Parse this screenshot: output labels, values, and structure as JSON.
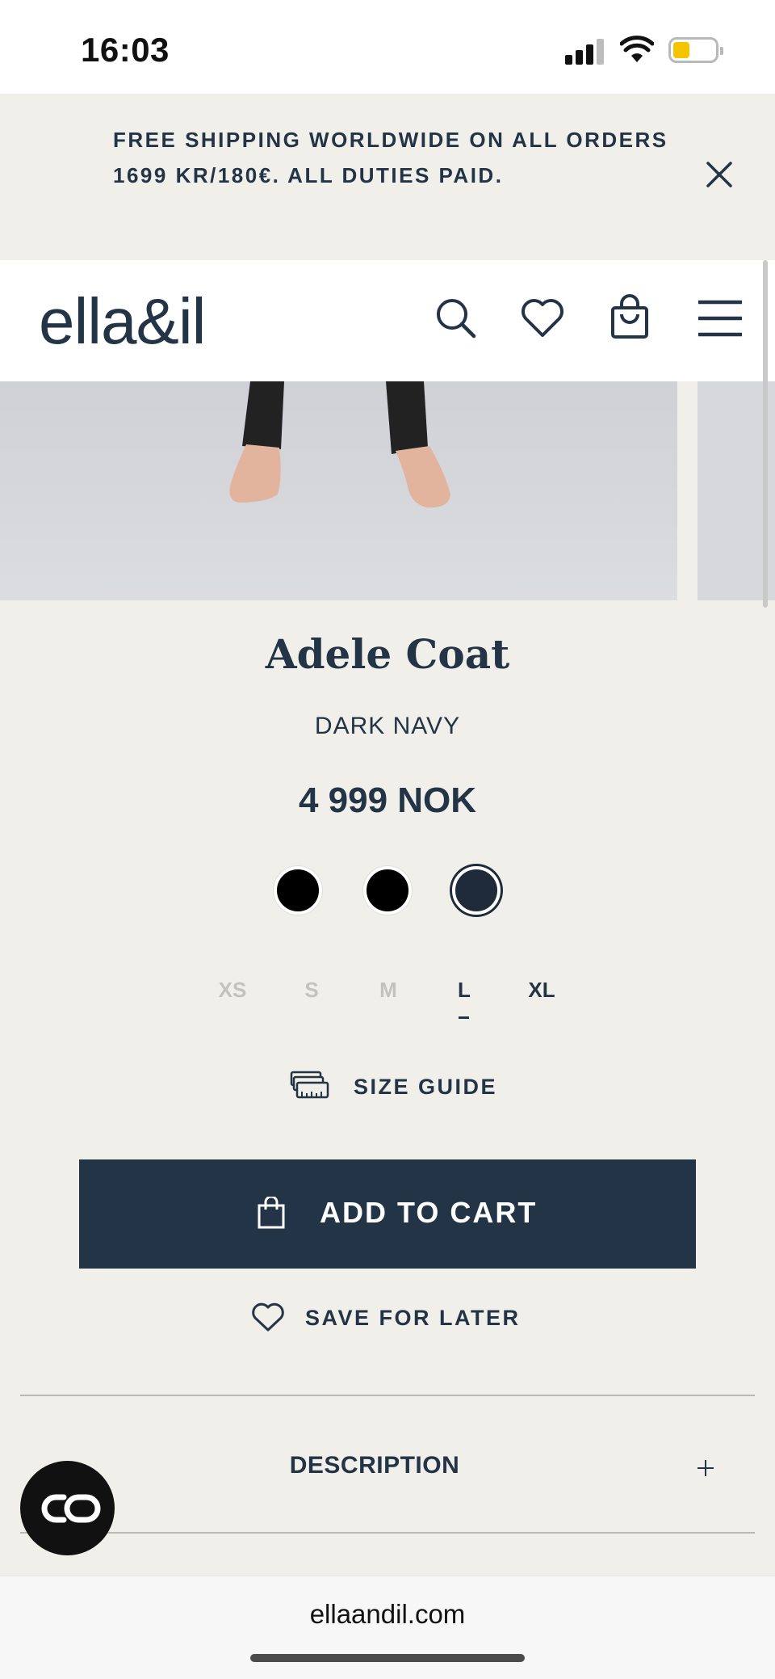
{
  "status_bar": {
    "time": "16:03"
  },
  "announcement": {
    "line1": "FREE SHIPPING WORLDWIDE ON ALL ORDERS",
    "line2": "1699 KR/180€.  ALL DUTIES PAID."
  },
  "header": {
    "logo": "ella&il",
    "icons": [
      "search-icon",
      "heart-icon",
      "bag-icon",
      "menu-icon"
    ]
  },
  "product": {
    "title": "Adele Coat",
    "color_name": "DARK NAVY",
    "price": "4 999 NOK",
    "swatches": [
      {
        "color": "#000000",
        "selected": false
      },
      {
        "color": "#000000",
        "selected": false
      },
      {
        "color": "#1f2a3a",
        "selected": true
      }
    ],
    "sizes": [
      {
        "label": "XS",
        "available": false
      },
      {
        "label": "S",
        "available": false
      },
      {
        "label": "M",
        "available": false
      },
      {
        "label": "L",
        "available": true,
        "selected": true
      },
      {
        "label": "XL",
        "available": true
      }
    ],
    "size_guide_label": "SIZE GUIDE",
    "add_to_cart_label": "ADD TO CART",
    "save_label": "SAVE FOR LATER",
    "description_label": "DESCRIPTION"
  },
  "browser": {
    "url": "ellaandil.com"
  },
  "colors": {
    "brand_navy": "#243447",
    "background": "#f1efe9"
  }
}
